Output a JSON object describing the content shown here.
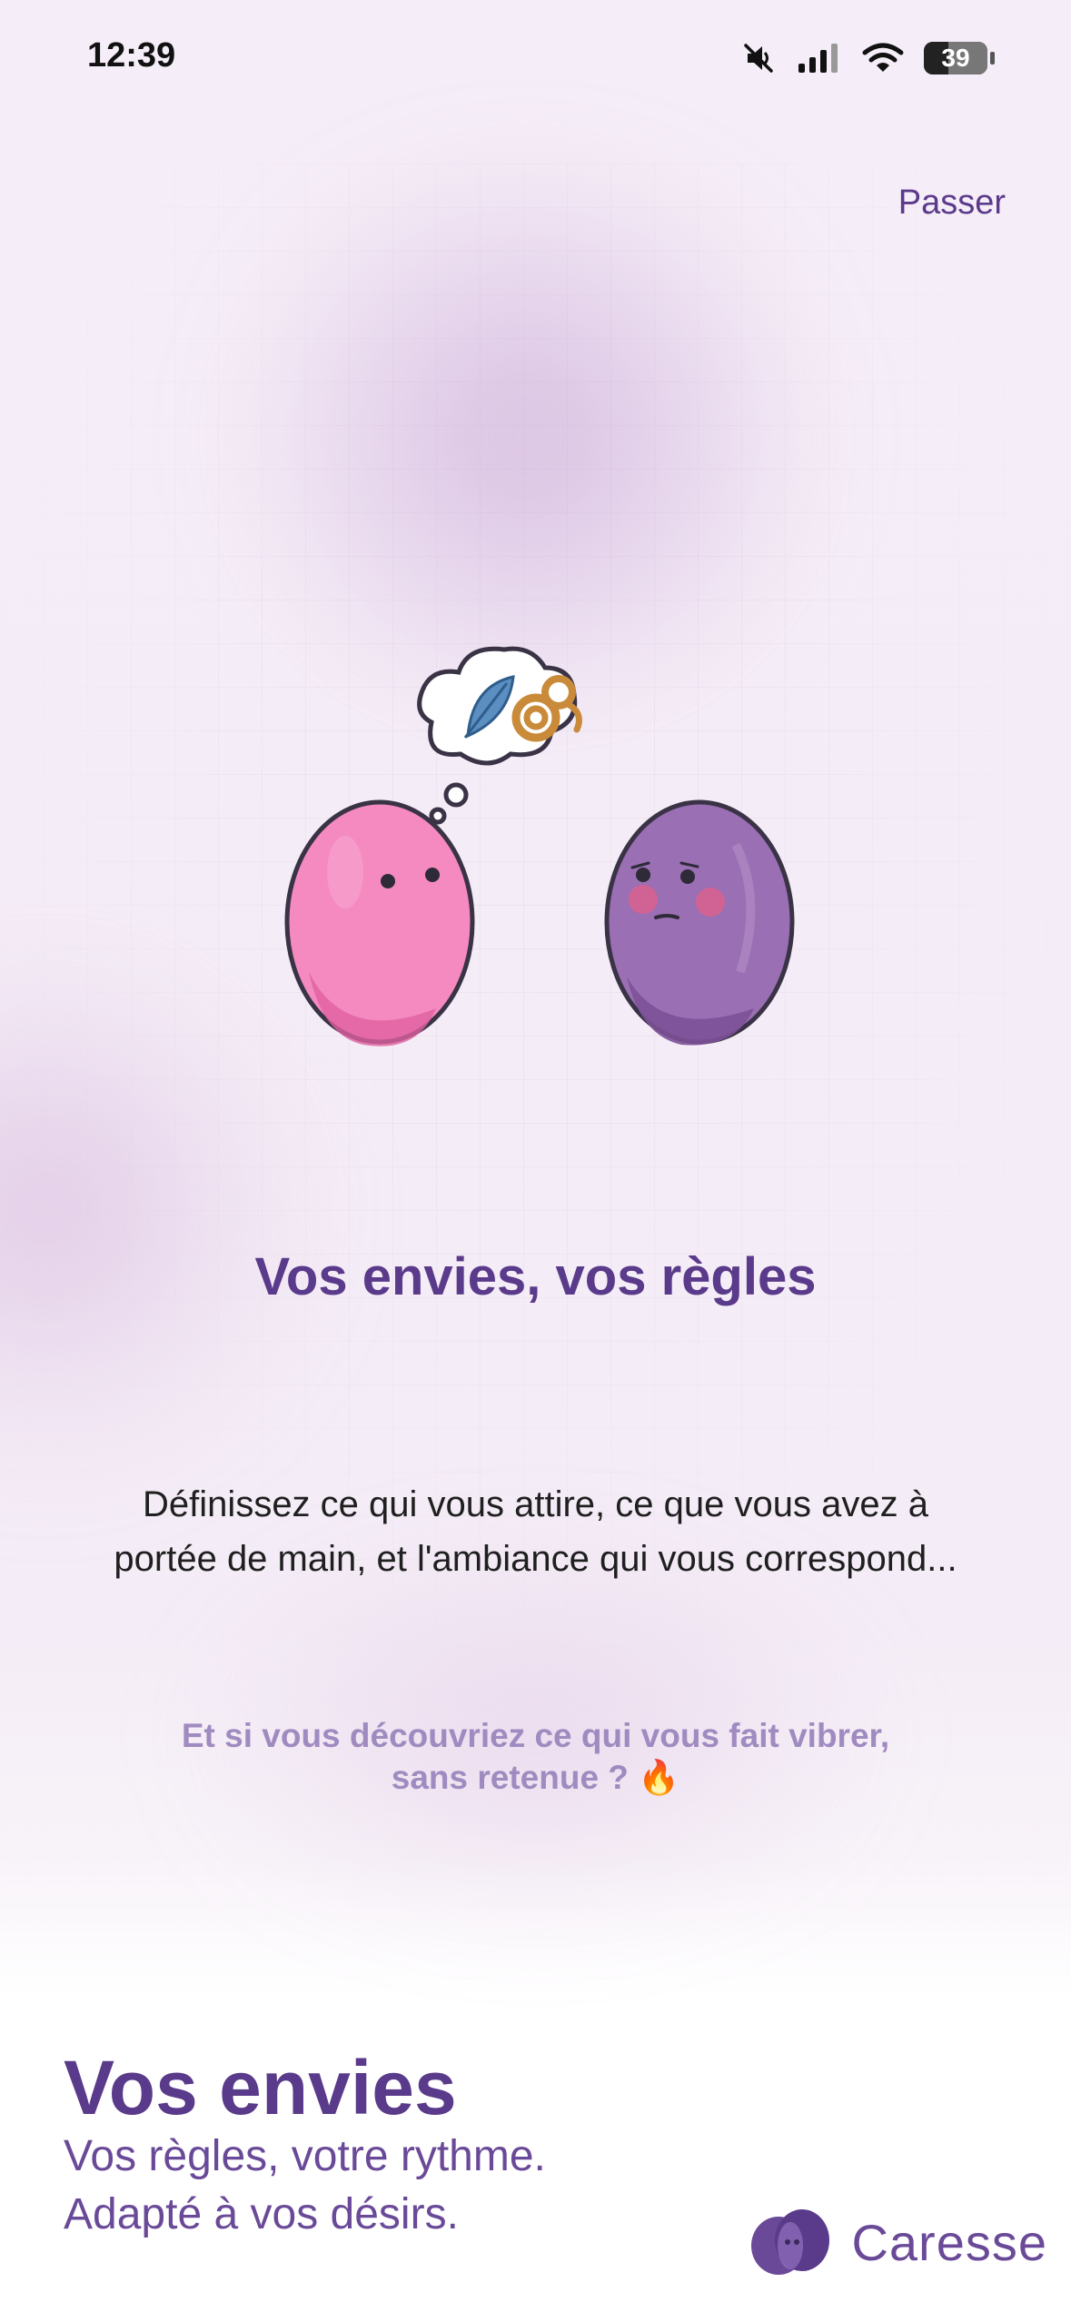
{
  "status_bar": {
    "time": "12:39",
    "battery_level": "39",
    "battery_fraction": 0.39,
    "icons": [
      "mute-icon",
      "signal-icon",
      "wifi-icon",
      "battery-icon"
    ]
  },
  "header": {
    "skip_label": "Passer"
  },
  "onboarding": {
    "title": "Vos envies, vos règles",
    "description_line1": "Définissez ce qui vous attire, ce que vous avez à",
    "description_line2": "portée de main, et l'ambiance qui vous correspond...",
    "teaser_line1": "Et si vous découvriez ce qui vous fait vibrer,",
    "teaser_line2": "sans retenue ? 🔥",
    "illustration_icons": [
      "feather-icon",
      "rope-icon",
      "pink-egg-character",
      "purple-egg-character"
    ]
  },
  "footer": {
    "headline": "Vos envies",
    "subline1": "Vos règles, votre rythme.",
    "subline2": "Adapté à vos désirs.",
    "brand": "Caresse"
  },
  "colors": {
    "accent": "#5a3a8a",
    "teaser": "#a08bc0",
    "pink": "#f58ac0",
    "purple": "#9a6fb3"
  }
}
